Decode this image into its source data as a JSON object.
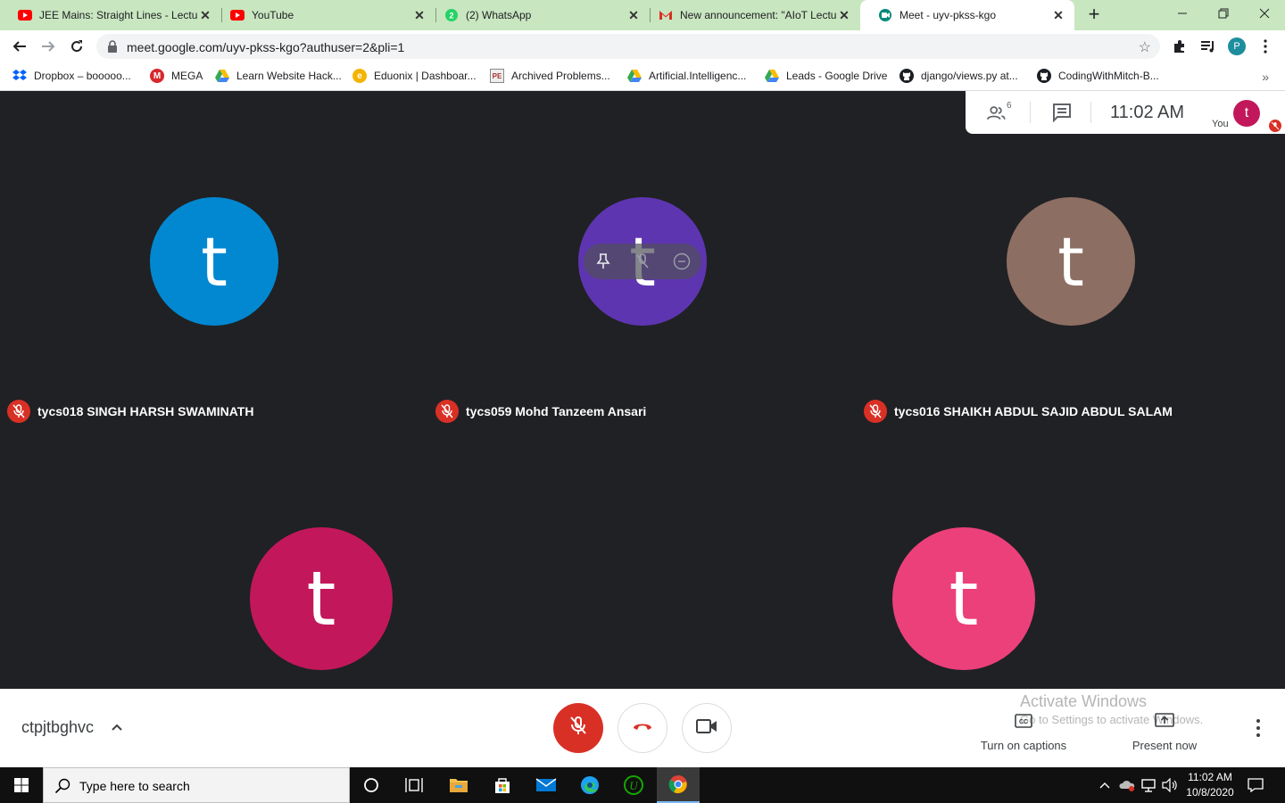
{
  "browser": {
    "tabs": [
      {
        "title": "JEE Mains: Straight Lines - Lecture",
        "favicon": "youtube-icon"
      },
      {
        "title": "YouTube",
        "favicon": "youtube-icon"
      },
      {
        "title": "(2) WhatsApp",
        "favicon": "whatsapp-icon"
      },
      {
        "title": "New announcement: \"AIoT Lecture",
        "favicon": "gmail-icon"
      },
      {
        "title": "Meet - uyv-pkss-kgo",
        "favicon": "meet-icon",
        "active": true
      }
    ],
    "url": "meet.google.com/uyv-pkss-kgo?authuser=2&pli=1",
    "profile_initial": "P",
    "bookmarks": [
      {
        "label": "Dropbox – booooo...",
        "icon": "dropbox-icon"
      },
      {
        "label": "MEGA",
        "icon": "mega-icon"
      },
      {
        "label": "Learn Website Hack...",
        "icon": "google-drive-icon"
      },
      {
        "label": "Eduonix | Dashboar...",
        "icon": "eduonix-icon"
      },
      {
        "label": "Archived Problems...",
        "icon": "archived-icon"
      },
      {
        "label": "Artificial.Intelligenc...",
        "icon": "google-drive-icon"
      },
      {
        "label": "Leads - Google Drive",
        "icon": "google-drive-icon"
      },
      {
        "label": "django/views.py at...",
        "icon": "github-icon"
      },
      {
        "label": "CodingWithMitch-B...",
        "icon": "github-icon"
      }
    ]
  },
  "meet": {
    "participant_count": "6",
    "time": "11:02  AM",
    "self": {
      "initial": "t",
      "label": "You"
    },
    "participants": [
      {
        "initial": "t",
        "name": "tycs018 SINGH HARSH SWAMINATH",
        "color": "#0288d1"
      },
      {
        "initial": "t",
        "name": "tycs059 Mohd Tanzeem Ansari",
        "color": "#5e35b1"
      },
      {
        "initial": "t",
        "name": "tycs016 SHAIKH ABDUL SAJID ABDUL SALAM",
        "color": "#8d6e63"
      },
      {
        "initial": "t",
        "name": "",
        "color": "#c2185b"
      },
      {
        "initial": "t",
        "name": "",
        "color": "#ec407a"
      }
    ],
    "meeting_code": "ctpjtbghvc",
    "captions_label": "Turn on captions",
    "present_label": "Present now",
    "watermark_line1": "Activate Windows",
    "watermark_line2": "Go to Settings to activate Windows."
  },
  "taskbar": {
    "search_placeholder": "Type here to search",
    "time": "11:02 AM",
    "date": "10/8/2020"
  }
}
